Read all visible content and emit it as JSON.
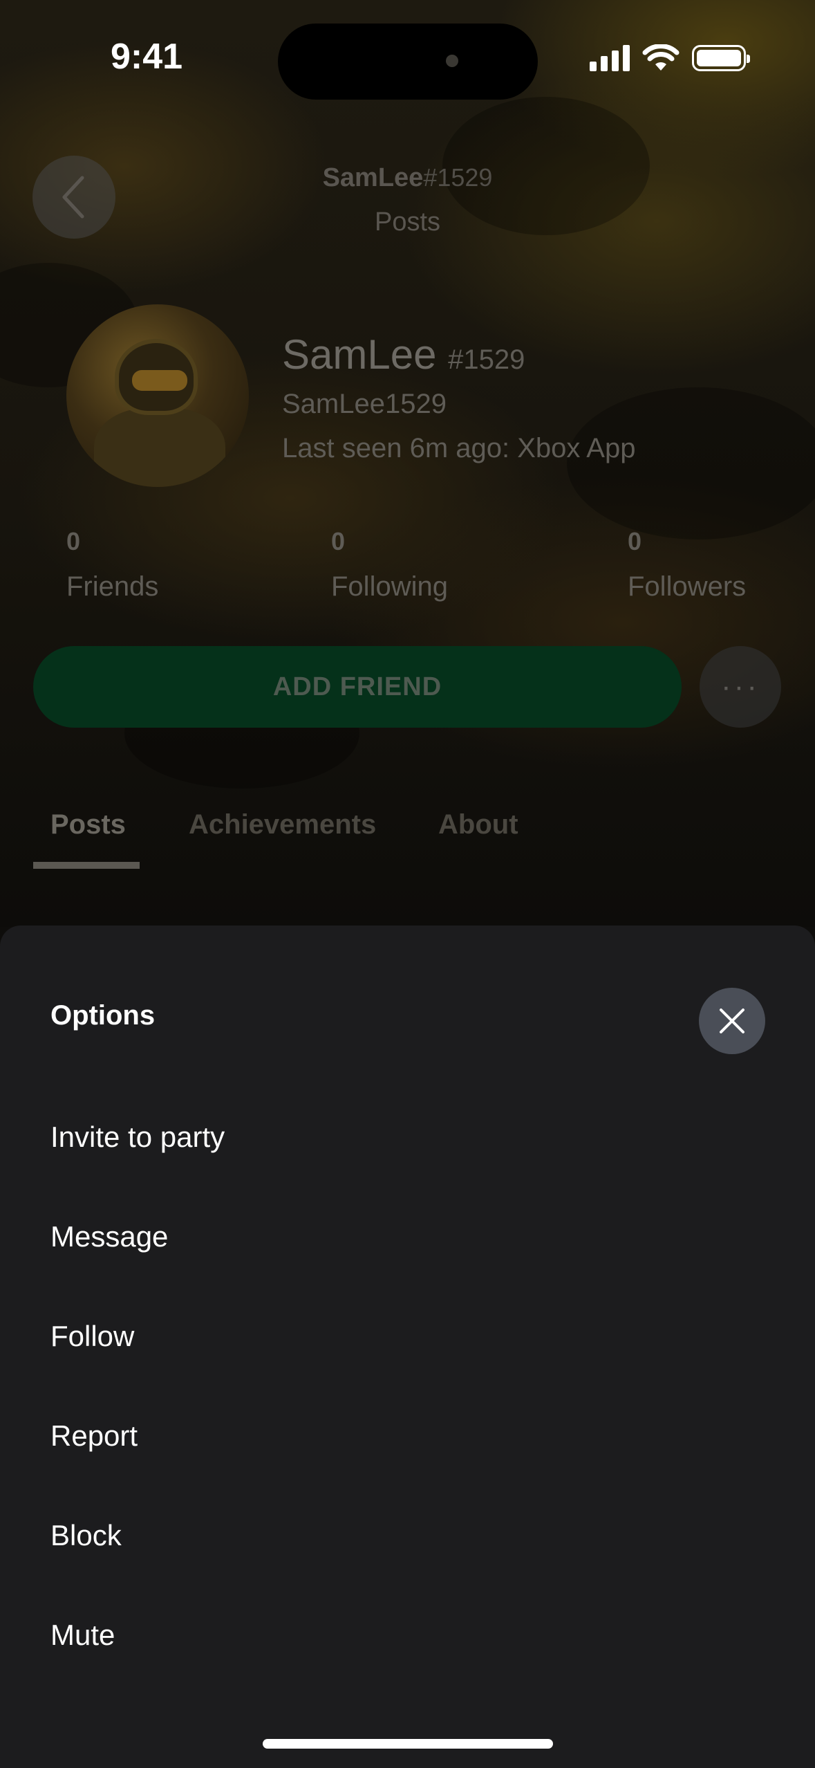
{
  "status_bar": {
    "time": "9:41"
  },
  "nav": {
    "gamertag": "SamLee",
    "gamertag_suffix": "#1529",
    "subtitle": "Posts"
  },
  "profile": {
    "name": "SamLee",
    "name_suffix": "#1529",
    "handle": "SamLee1529",
    "last_seen": "Last seen 6m ago: Xbox App"
  },
  "stats": [
    {
      "count": "0",
      "label": "Friends"
    },
    {
      "count": "0",
      "label": "Following"
    },
    {
      "count": "0",
      "label": "Followers"
    }
  ],
  "actions": {
    "add_friend": "ADD FRIEND",
    "more": "···"
  },
  "tabs": [
    "Posts",
    "Achievements",
    "About"
  ],
  "sheet": {
    "title": "Options",
    "items": [
      "Invite to party",
      "Message",
      "Follow",
      "Report",
      "Block",
      "Mute"
    ]
  },
  "colors": {
    "accent_green": "#05311a",
    "sheet_bg": "#1c1c1e",
    "close_button": "#4a4e57"
  }
}
